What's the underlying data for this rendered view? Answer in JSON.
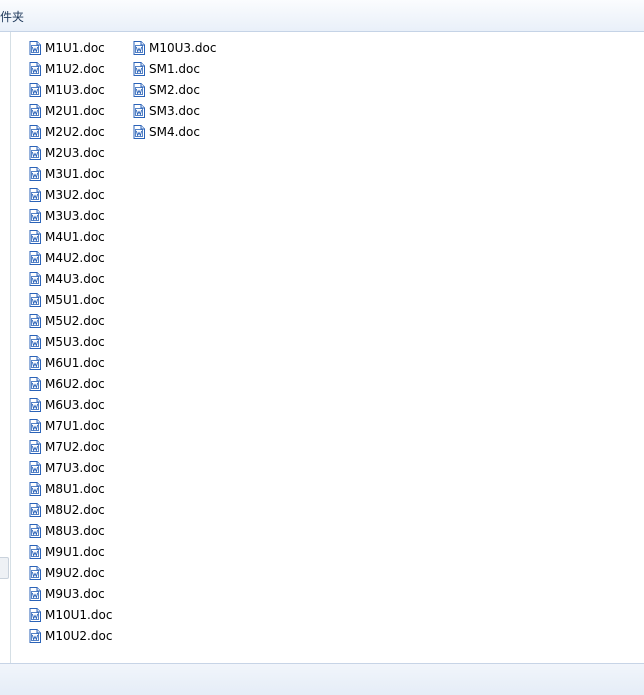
{
  "toolbar": {
    "label": "件夹"
  },
  "file_list": {
    "column_1": [
      "M1U1.doc",
      "M1U2.doc",
      "M1U3.doc",
      "M2U1.doc",
      "M2U2.doc",
      "M2U3.doc",
      "M3U1.doc",
      "M3U2.doc",
      "M3U3.doc",
      "M4U1.doc",
      "M4U2.doc",
      "M4U3.doc",
      "M5U1.doc",
      "M5U2.doc",
      "M5U3.doc",
      "M6U1.doc",
      "M6U2.doc",
      "M6U3.doc",
      "M7U1.doc",
      "M7U2.doc",
      "M7U3.doc",
      "M8U1.doc",
      "M8U2.doc",
      "M8U3.doc",
      "M9U1.doc",
      "M9U2.doc",
      "M9U3.doc",
      "M10U1.doc",
      "M10U2.doc"
    ],
    "column_2": [
      "M10U3.doc",
      "SM1.doc",
      "SM2.doc",
      "SM3.doc",
      "SM4.doc"
    ],
    "item_icon": "word-document-icon"
  },
  "colors": {
    "toolbar_text": "#1e395b",
    "icon_blue": "#2b63b8",
    "divider": "#c5d3e6"
  }
}
